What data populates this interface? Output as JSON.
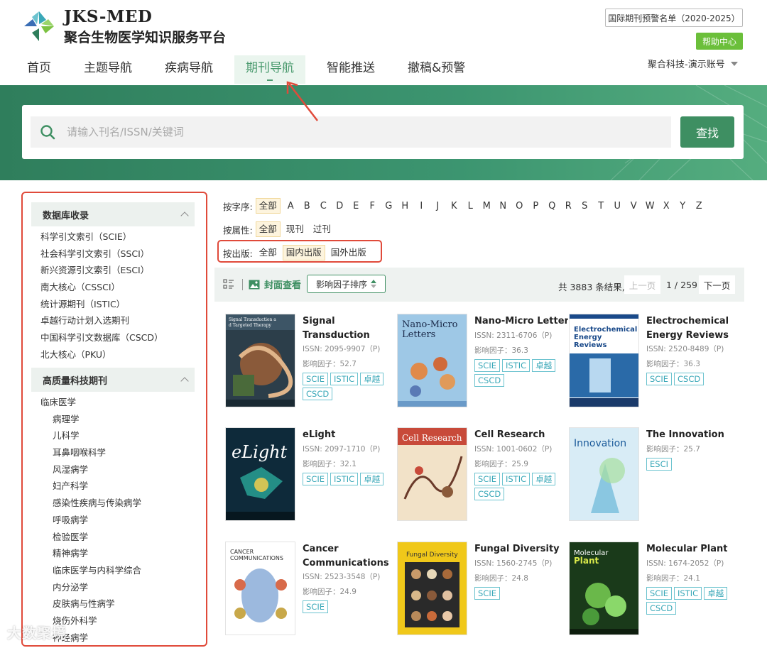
{
  "header": {
    "logo_title": "JKS-MED",
    "logo_subtitle": "聚合生物医学知识服务平台",
    "warn_button": "国际期刊预警名单（2020-2025）",
    "help_button": "帮助中心",
    "account": "聚合科技-演示账号"
  },
  "nav": {
    "items": [
      "首页",
      "主题导航",
      "疾病导航",
      "期刊导航",
      "智能推送",
      "撤稿&预警"
    ],
    "active_index": 3
  },
  "search": {
    "placeholder": "请输入刊名/ISSN/关键词",
    "button": "查找"
  },
  "sidebar": {
    "group1": {
      "title": "数据库收录",
      "items": [
        "科学引文索引（SCIE）",
        "社会科学引文索引（SSCI）",
        "新兴资源引文索引（ESCI）",
        "南大核心（CSSCI）",
        "统计源期刊（ISTIC）",
        "卓越行动计划入选期刊",
        "中国科学引文数据库（CSCD）",
        "北大核心（PKU）"
      ]
    },
    "group2": {
      "title": "高质量科技期刊",
      "parent": "临床医学",
      "items": [
        "病理学",
        "儿科学",
        "耳鼻咽喉科学",
        "风湿病学",
        "妇产科学",
        "感染性疾病与传染病学",
        "呼吸病学",
        "检验医学",
        "精神病学",
        "临床医学与内科学综合",
        "内分泌学",
        "皮肤病与性病学",
        "烧伤外科学",
        "神经病学"
      ]
    }
  },
  "filters": {
    "alpha_label": "按字序:",
    "alpha_all": "全部",
    "letters": [
      "A",
      "B",
      "C",
      "D",
      "E",
      "F",
      "G",
      "H",
      "I",
      "J",
      "K",
      "L",
      "M",
      "N",
      "O",
      "P",
      "Q",
      "R",
      "S",
      "T",
      "U",
      "V",
      "W",
      "X",
      "Y",
      "Z"
    ],
    "attr_label": "按属性:",
    "attr_options": [
      "全部",
      "现刊",
      "过刊"
    ],
    "pub_label": "按出版:",
    "pub_options": [
      "全部",
      "国内出版",
      "国外出版"
    ]
  },
  "toolbar": {
    "cover_view": "封面查看",
    "sort": "影响因子排序",
    "total": "共 3883 条结果,",
    "prev": "上一页",
    "page": "1 / 259",
    "next": "下一页"
  },
  "journals": [
    {
      "title": "Signal Transduction an...",
      "issn": "ISSN:  2095-9907（P)",
      "if": "影响因子：52.7",
      "tags": [
        "SCIE",
        "ISTIC",
        "卓越",
        "CSCD"
      ],
      "cover_text": "Signal Transduction and Targeted Therapy"
    },
    {
      "title": "Nano-Micro Letters",
      "issn": "ISSN:  2311-6706（P)",
      "if": "影响因子：36.3",
      "tags": [
        "SCIE",
        "ISTIC",
        "卓越",
        "CSCD"
      ],
      "cover_text": "Nano-Micro Letters"
    },
    {
      "title": "Electrochemical Energy Reviews",
      "issn": "ISSN:  2520-8489（P)",
      "if": "影响因子：36.3",
      "tags": [
        "SCIE",
        "CSCD"
      ],
      "cover_text": "Electrochemical Energy Reviews"
    },
    {
      "title": "eLight",
      "issn": "ISSN:  2097-1710（P)",
      "if": "影响因子：32.1",
      "tags": [
        "SCIE",
        "ISTIC",
        "卓越"
      ],
      "cover_text": "eLight"
    },
    {
      "title": "Cell Research",
      "issn": "ISSN:  1001-0602（P)",
      "if": "影响因子：25.9",
      "tags": [
        "SCIE",
        "ISTIC",
        "卓越",
        "CSCD"
      ],
      "cover_text": "Cell Research"
    },
    {
      "title": "The Innovation",
      "issn": "",
      "if": "影响因子：25.7",
      "tags": [
        "ESCI"
      ],
      "cover_text": "The Innovation"
    },
    {
      "title": "Cancer Communications",
      "issn": "ISSN:  2523-3548（P)",
      "if": "影响因子：24.9",
      "tags": [
        "SCIE"
      ],
      "cover_text": "Cancer Communications"
    },
    {
      "title": "Fungal Diversity",
      "issn": "ISSN:  1560-2745（P)",
      "if": "影响因子：24.8",
      "tags": [
        "SCIE"
      ],
      "cover_text": "Fungal Diversity"
    },
    {
      "title": "Molecular Plant",
      "issn": "ISSN:  1674-2052（P)",
      "if": "影响因子：24.1",
      "tags": [
        "SCIE",
        "ISTIC",
        "卓越",
        "CSCD"
      ],
      "cover_text": "Molecular Plant"
    }
  ],
  "watermark": "大数聚境",
  "colors": {
    "brand_green": "#3e8f62",
    "highlight_red": "#e04a3a",
    "tag_teal": "#3aa8b8",
    "help_green": "#6bbf3a"
  }
}
